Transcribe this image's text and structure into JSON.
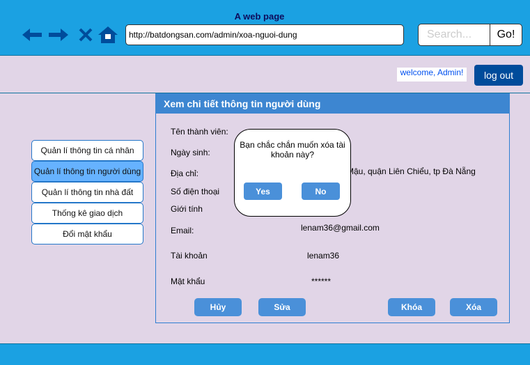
{
  "browser": {
    "title": "A web page",
    "url": "http://batdongsan.com/admin/xoa-nguoi-dung",
    "search_placeholder": "Search...",
    "go_label": "Go!",
    "icons": [
      "back-icon",
      "forward-icon",
      "close-icon",
      "home-icon"
    ],
    "icon_color": "#004c9b"
  },
  "header": {
    "welcome": "welcome, Admin!",
    "logout_label": "log out"
  },
  "sidebar": {
    "items": [
      {
        "label": "Quản lí thông tin cá nhân"
      },
      {
        "label": "Quản lí thông tin người dùng"
      },
      {
        "label": "Quản lí thông tin nhà đất"
      },
      {
        "label": "Thống kê giao dịch"
      },
      {
        "label": "Đổi mật khẩu"
      }
    ]
  },
  "panel": {
    "title": "Xem chi tiết thông tin người dùng",
    "fields": {
      "username_label": "Tên thành viên:",
      "dob_label": "Ngày sinh:",
      "address_label": "Địa chỉ:",
      "address_value": "Mậu, quận Liên Chiểu, tp Đà Nẵng",
      "phone_label": "Số điện thoại",
      "gender_label": "Giới tính",
      "email_label": "Email:",
      "email_value": "lenam36@gmail.com",
      "account_label": "Tài khoản",
      "account_value": "lenam36",
      "password_label": "Mật khẩu",
      "password_value": "******"
    },
    "buttons": {
      "cancel": "Hủy",
      "edit": "Sửa",
      "lock": "Khóa",
      "delete": "Xóa"
    }
  },
  "dialog": {
    "message": "Bạn chắc chắn muốn xóa tài khoản này?",
    "yes_label": "Yes",
    "no_label": "No"
  },
  "colors": {
    "topbar": "#1ba1e2",
    "background": "#e1d5e7",
    "button": "#4a90d9",
    "panel_header": "#3d86d1",
    "active_item": "#66b2ff"
  }
}
